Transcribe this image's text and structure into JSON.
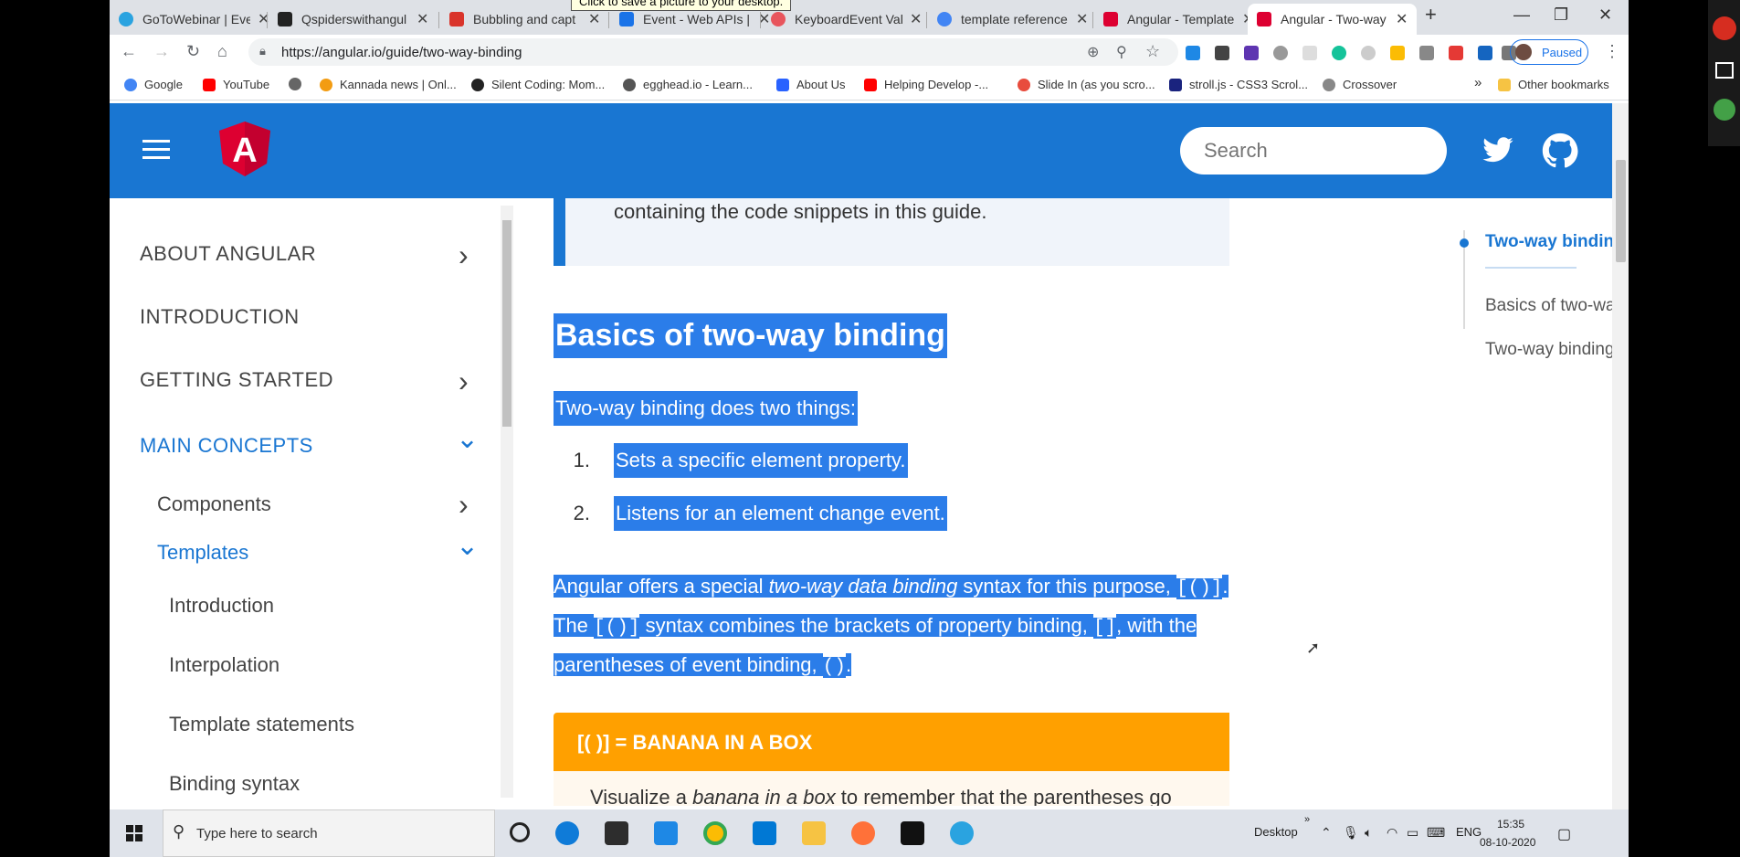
{
  "browser": {
    "tabs": [
      {
        "label": "GoToWebinar | Eve",
        "color": "#2aa3e0"
      },
      {
        "label": "Qspiderswithangul",
        "color": "#222222"
      },
      {
        "label": "Bubbling and capt",
        "color": "#d9342b"
      },
      {
        "label": "Event - Web APIs |",
        "color": "#1a73e8"
      },
      {
        "label": "KeyboardEvent Val",
        "color": "#e8555d"
      },
      {
        "label": "template reference",
        "color": "#4285f4"
      },
      {
        "label": "Angular - Template",
        "color": "#dd0031"
      },
      {
        "label": "Angular - Two-way",
        "color": "#dd0031",
        "active": true
      }
    ],
    "new_tab": "+",
    "window_controls": {
      "minimize": "—",
      "maximize": "❐",
      "close": "✕"
    },
    "url": "https://angular.io/guide/two-way-binding",
    "paused_label": "Paused",
    "bookmarks": [
      {
        "label": "Google",
        "color": "#4285f4"
      },
      {
        "label": "YouTube",
        "color": "#ff0000"
      },
      {
        "label": "",
        "color": "#666666"
      },
      {
        "label": "Kannada news | Onl...",
        "color": "#f39c12"
      },
      {
        "label": "Silent Coding: Mom...",
        "color": "#222222"
      },
      {
        "label": "egghead.io - Learn...",
        "color": "#555555"
      },
      {
        "label": "About Us",
        "color": "#2962ff"
      },
      {
        "label": "Helping Develop -...",
        "color": "#ff0000"
      },
      {
        "label": "Slide In (as you scro...",
        "color": "#e84c3d"
      },
      {
        "label": "stroll.js - CSS3 Scrol...",
        "color": "#1a237e"
      },
      {
        "label": "Crossover",
        "color": "#888888"
      }
    ],
    "bookmarks_more": "»",
    "other_bookmarks": "Other bookmarks",
    "tooltip": "Click to save a picture to your desktop."
  },
  "site": {
    "logo_letter": "A",
    "search_placeholder": "Search"
  },
  "sidebar": {
    "items": [
      {
        "label": "ABOUT ANGULAR",
        "chevron": "›"
      },
      {
        "label": "INTRODUCTION",
        "chevron": ""
      },
      {
        "label": "GETTING STARTED",
        "chevron": "›"
      },
      {
        "label": "MAIN CONCEPTS",
        "chevron": "⌄"
      },
      {
        "label": "Components",
        "chevron": "›"
      },
      {
        "label": "Templates",
        "chevron": "⌄"
      },
      {
        "label": "Introduction",
        "chevron": ""
      },
      {
        "label": "Interpolation",
        "chevron": ""
      },
      {
        "label": "Template statements",
        "chevron": ""
      },
      {
        "label": "Binding syntax",
        "chevron": ""
      }
    ]
  },
  "content": {
    "callout_text": "containing the code snippets in this guide.",
    "heading": "Basics of two-way binding",
    "intro": "Two-way binding does two things:",
    "list": [
      {
        "num": "1.",
        "text": "Sets a specific element property."
      },
      {
        "num": "2.",
        "text": "Listens for an element change event."
      }
    ],
    "para": {
      "l1a": "Angular offers a special ",
      "l1em": "two-way data binding",
      "l1b": " syntax for this purpose, ",
      "l1code": "[()]",
      "l1c": ".",
      "l2a": "The ",
      "l2code": "[()]",
      "l2b": " syntax combines the brackets of property binding, ",
      "l2code2": "[]",
      "l2c": ", with the",
      "l3a": "parentheses of event binding, ",
      "l3code": "()",
      "l3b": "."
    },
    "banana_title": "[( )] = BANANA IN A BOX",
    "banana_text_a": "Visualize a ",
    "banana_text_em": "banana in a box",
    "banana_text_b": " to remember that the parentheses go"
  },
  "toc": {
    "active_title": "Two-way binding",
    "active_code": "[(...)]",
    "items": [
      "Basics of two-way binding",
      "Two-way binding in forms"
    ]
  },
  "taskbar": {
    "search_placeholder": "Type here to search",
    "desktop_label": "Desktop",
    "chevron": "»",
    "lang": "ENG",
    "time": "15:35",
    "date": "08-10-2020"
  }
}
